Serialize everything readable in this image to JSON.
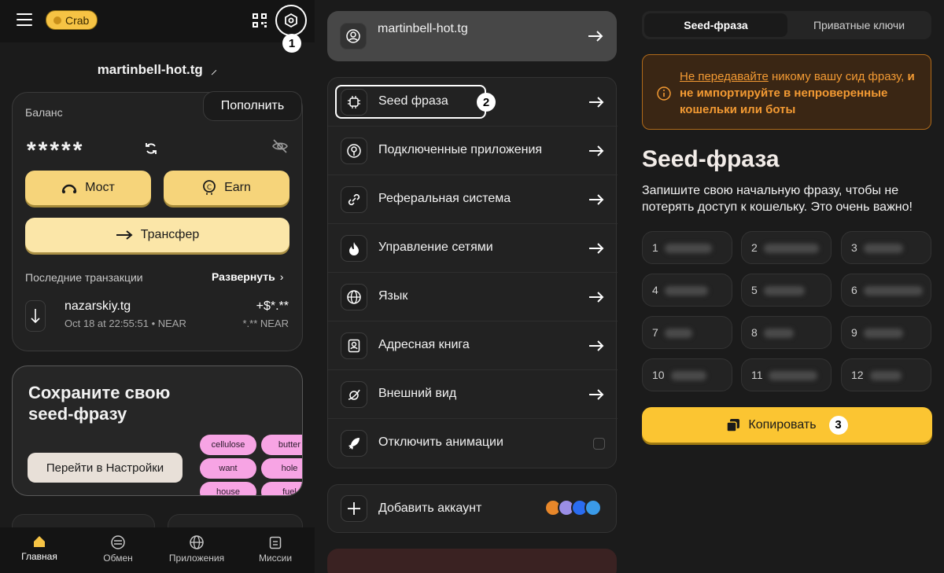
{
  "panel1": {
    "badge": "Crab",
    "step1": "1",
    "account": "martinbell-hot.tg",
    "topup": "Пополнить",
    "balance_label": "Баланс",
    "balance_value": "*****",
    "bridge": "Мост",
    "earn": "Earn",
    "transfer": "Трансфер",
    "tx_label": "Последние транзакции",
    "tx_expand": "Развернуть",
    "tx": {
      "name": "nazarskiy.tg",
      "date": "Oct 18 at 22:55:51 • NEAR",
      "amount": "+$*.**",
      "sub": "*.** NEAR"
    },
    "seed_title": "Сохраните свою seed-фразу",
    "seed_go": "Перейти в Настройки",
    "pills": [
      "cellulose",
      "butter",
      "want",
      "hole",
      "house",
      "fuel"
    ],
    "nav": [
      "Главная",
      "Обмен",
      "Приложения",
      "Миссии"
    ]
  },
  "panel2": {
    "account": "martinbell-hot.tg",
    "step2": "2",
    "menu": [
      {
        "label": "Seed фраза",
        "icon": "chip-icon"
      },
      {
        "label": "Подключенные приложения",
        "icon": "apps-icon"
      },
      {
        "label": "Реферальная система",
        "icon": "link-icon"
      },
      {
        "label": "Управление сетями",
        "icon": "fire-icon"
      },
      {
        "label": "Язык",
        "icon": "globe-icon"
      },
      {
        "label": "Адресная книга",
        "icon": "contacts-icon"
      },
      {
        "label": "Внешний вид",
        "icon": "planet-icon"
      },
      {
        "label": "Отключить анимации",
        "icon": "rocket-icon"
      }
    ],
    "add_account": "Добавить аккаунт"
  },
  "panel3": {
    "tab_seed": "Seed-фраза",
    "tab_keys": "Приватные ключи",
    "warn_part1": "Не передавайте",
    "warn_part2": " никому вашу сид фразу, ",
    "warn_part3": "и не импортируйте в непроверенные кошельки или боты",
    "heading": "Seed-фраза",
    "description": "Запишите свою начальную фразу, чтобы не потерять доступ к кошельку. Это очень важно!",
    "word_numbers": [
      "1",
      "2",
      "3",
      "4",
      "5",
      "6",
      "7",
      "8",
      "9",
      "10",
      "11",
      "12"
    ],
    "copy": "Копировать",
    "step3": "3"
  },
  "colors": {
    "accent": "#fbc532",
    "warning": "#f39a33",
    "pill": "#f7a4e4"
  }
}
